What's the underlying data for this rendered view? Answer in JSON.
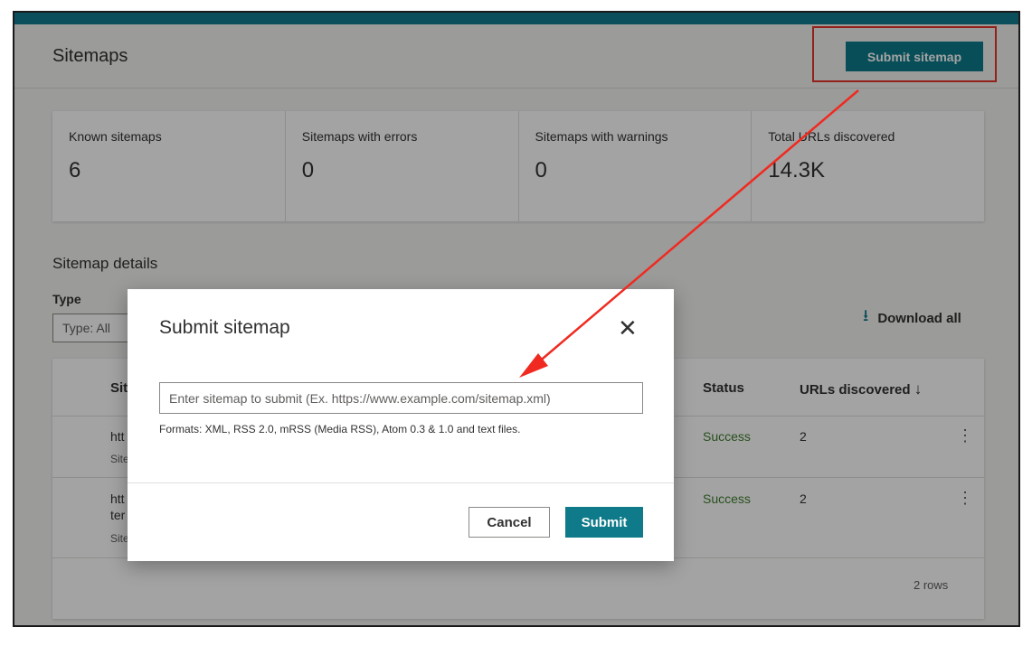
{
  "header": {
    "title": "Sitemaps",
    "submit_label": "Submit sitemap"
  },
  "stats": [
    {
      "label": "Known sitemaps",
      "value": "6"
    },
    {
      "label": "Sitemaps with errors",
      "value": "0"
    },
    {
      "label": "Sitemaps with warnings",
      "value": "0"
    },
    {
      "label": "Total URLs discovered",
      "value": "14.3K"
    }
  ],
  "details": {
    "title": "Sitemap details",
    "type_label": "Type",
    "type_value": "Type: All",
    "download_label": "Download all",
    "columns": {
      "sitemap": "Site",
      "status": "Status",
      "urls": "URLs discovered"
    },
    "rows": [
      {
        "link": "htt",
        "link2": "",
        "sub": "Site",
        "status": "Success",
        "urls": "2"
      },
      {
        "link": "htt",
        "link2": "ter",
        "sub": "Site",
        "status": "Success",
        "urls": "2"
      }
    ],
    "rows_count": "2 rows"
  },
  "dialog": {
    "title": "Submit sitemap",
    "placeholder": "Enter sitemap to submit (Ex. https://www.example.com/sitemap.xml)",
    "formats": "Formats: XML, RSS 2.0, mRSS (Media RSS), Atom 0.3 & 1.0 and text files.",
    "cancel_label": "Cancel",
    "submit_label": "Submit"
  },
  "colors": {
    "accent": "#0e7a8a",
    "topbar": "#0b4f5c",
    "annotation": "#e63329",
    "success": "#3f7e2e"
  }
}
